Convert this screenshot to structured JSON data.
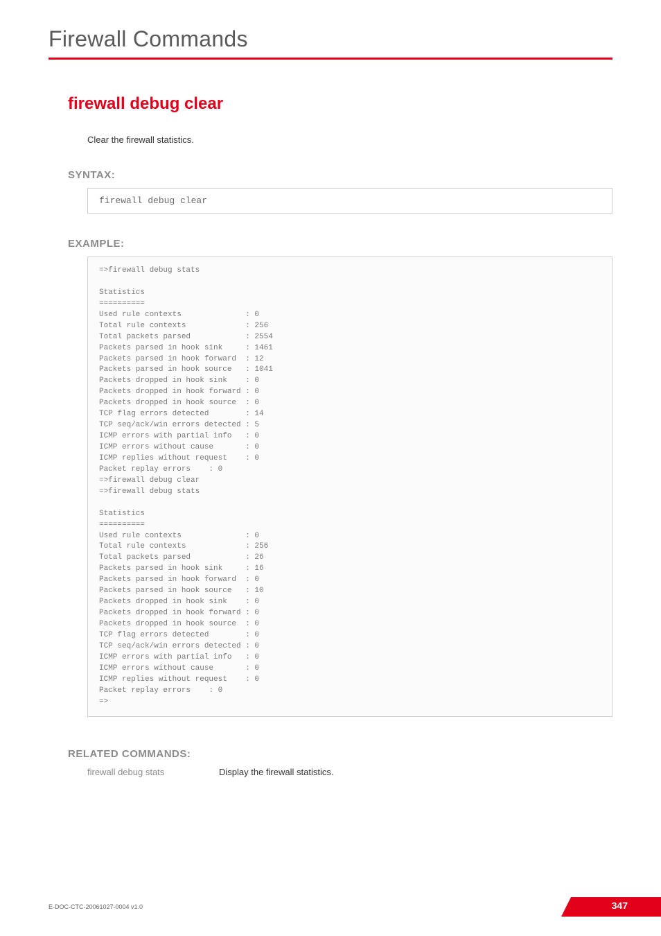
{
  "chapter": "Firewall Commands",
  "command_title": "firewall debug clear",
  "description": "Clear the firewall statistics.",
  "headings": {
    "syntax": "SYNTAX:",
    "example": "EXAMPLE:",
    "related": "RELATED COMMANDS:"
  },
  "syntax": "firewall debug clear",
  "example": "=>firewall debug stats\n\nStatistics\n==========\nUsed rule contexts              : 0\nTotal rule contexts             : 256\nTotal packets parsed            : 2554\nPackets parsed in hook sink     : 1461\nPackets parsed in hook forward  : 12\nPackets parsed in hook source   : 1041\nPackets dropped in hook sink    : 0\nPackets dropped in hook forward : 0\nPackets dropped in hook source  : 0\nTCP flag errors detected        : 14\nTCP seq/ack/win errors detected : 5\nICMP errors with partial info   : 0\nICMP errors without cause       : 0\nICMP replies without request    : 0\nPacket replay errors    : 0\n=>firewall debug clear\n=>firewall debug stats\n\nStatistics\n==========\nUsed rule contexts              : 0\nTotal rule contexts             : 256\nTotal packets parsed            : 26\nPackets parsed in hook sink     : 16\nPackets parsed in hook forward  : 0\nPackets parsed in hook source   : 10\nPackets dropped in hook sink    : 0\nPackets dropped in hook forward : 0\nPackets dropped in hook source  : 0\nTCP flag errors detected        : 0\nTCP seq/ack/win errors detected : 0\nICMP errors with partial info   : 0\nICMP errors without cause       : 0\nICMP replies without request    : 0\nPacket replay errors    : 0\n=>",
  "related": {
    "cmd": "firewall debug stats",
    "desc": "Display the firewall statistics."
  },
  "footer": {
    "doc_id": "E-DOC-CTC-20061027-0004 v1.0",
    "page": "347"
  }
}
